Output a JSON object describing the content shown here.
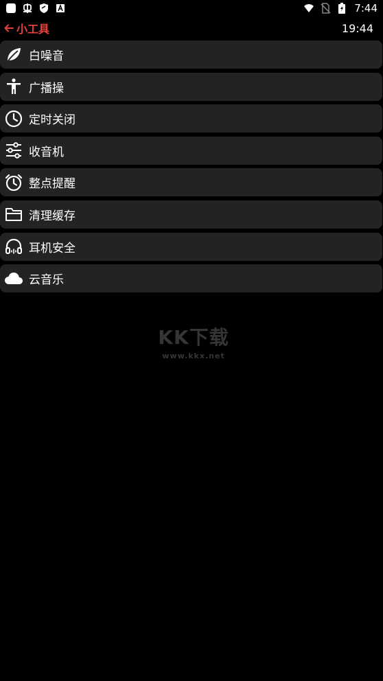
{
  "status_bar": {
    "time": "7:44",
    "left_icons": [
      "app-square-icon",
      "bug-icon",
      "shield-icon",
      "font-a-icon"
    ],
    "right_icons": [
      "wifi-icon",
      "no-sim-icon",
      "battery-charging-icon"
    ]
  },
  "toolbar": {
    "title": "小工具",
    "clock": "19:44",
    "accent_color": "#e8403a"
  },
  "menu": {
    "items": [
      {
        "label": "白噪音",
        "icon": "leaf-icon"
      },
      {
        "label": "广播操",
        "icon": "person-icon"
      },
      {
        "label": "定时关闭",
        "icon": "clock-icon"
      },
      {
        "label": "收音机",
        "icon": "sliders-icon"
      },
      {
        "label": "整点提醒",
        "icon": "alarm-icon"
      },
      {
        "label": "清理缓存",
        "icon": "folder-icon"
      },
      {
        "label": "耳机安全",
        "icon": "headphones-icon"
      },
      {
        "label": "云音乐",
        "icon": "cloud-icon"
      }
    ]
  },
  "watermark": {
    "main": "KK下载",
    "sub": "www.kkx.net"
  },
  "colors": {
    "background": "#000000",
    "item_background": "#232323",
    "text": "#ffffff"
  }
}
